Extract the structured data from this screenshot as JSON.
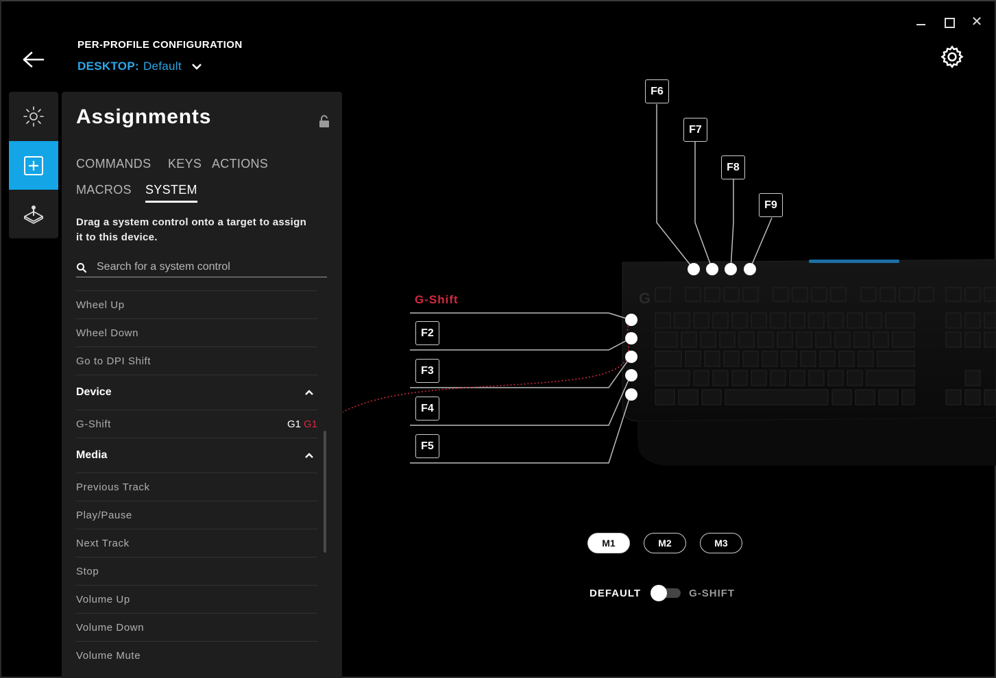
{
  "window": {
    "minimize_icon": "minimize-icon",
    "maximize_icon": "maximize-icon",
    "close_glyph": "✕"
  },
  "header": {
    "title": "PER-PROFILE CONFIGURATION",
    "profile_label": "DESKTOP:",
    "profile_value": "Default"
  },
  "rail": {
    "items": [
      "lighting-icon",
      "assignments-icon",
      "gaming-mode-icon"
    ],
    "accent": "#13a5e6"
  },
  "panel": {
    "title": "Assignments",
    "tabs": [
      "COMMANDS",
      "KEYS",
      "ACTIONS",
      "MACROS",
      "SYSTEM"
    ],
    "active_tab": "SYSTEM",
    "description": "Drag a system control onto a target to assign it to this device.",
    "search": {
      "placeholder": "Search for a system control",
      "value": ""
    },
    "top_items": [
      "Wheel Up",
      "Wheel Down",
      "Go to DPI Shift"
    ],
    "device_section": {
      "title": "Device",
      "items": [
        {
          "label": "G-Shift",
          "binding": "G1",
          "shift_binding": "G1"
        }
      ]
    },
    "media_section": {
      "title": "Media",
      "items": [
        "Previous Track",
        "Play/Pause",
        "Next Track",
        "Stop",
        "Volume Up",
        "Volume Down",
        "Volume Mute"
      ]
    }
  },
  "scene": {
    "gshift_label": "G-Shift",
    "left_keys": [
      "F2",
      "F3",
      "F4",
      "F5"
    ],
    "top_keys": [
      "F6",
      "F7",
      "F8",
      "F9"
    ],
    "modes": [
      "M1",
      "M2",
      "M3"
    ],
    "active_mode": "M1",
    "toggle": {
      "left": "DEFAULT",
      "right": "G-SHIFT",
      "state": "DEFAULT"
    },
    "shift_color": "#d2293f"
  }
}
